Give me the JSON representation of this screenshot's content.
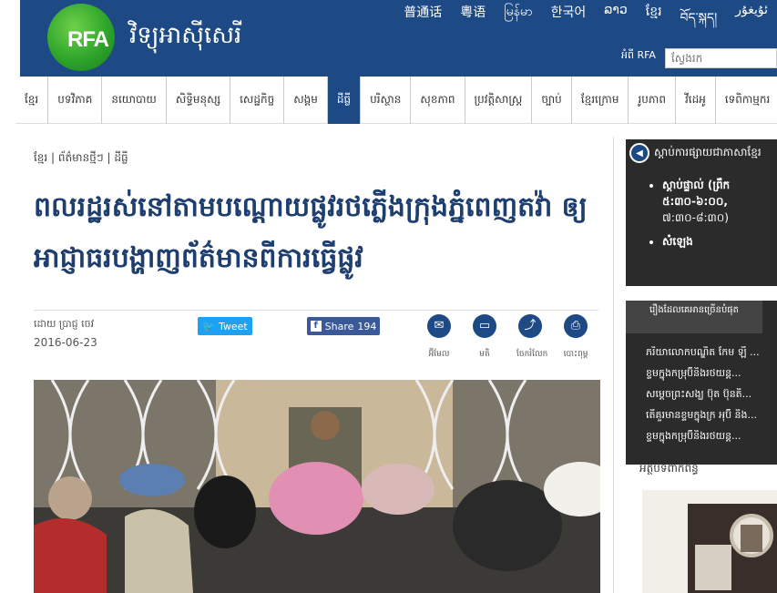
{
  "header": {
    "logo": "RFA",
    "site_name": "វិទ្យុអាស៊ីសេរី",
    "languages": [
      "普通话",
      "粵语",
      "မြန်မာ",
      "한국어",
      "ລາວ",
      "ខ្មែរ",
      "བོད་སྐད།",
      "ئۇيغۇر"
    ],
    "about": "អំពី RFA",
    "search_placeholder": "ស្វែងរក"
  },
  "nav": {
    "items": [
      "ខ្មែរ",
      "បទវិភាគ",
      "នយោបាយ",
      "សិទ្ធិមនុស្ស",
      "សេដ្ឋកិច្ច",
      "សង្គម",
      "ដីធ្លី",
      "បរិស្ថាន",
      "សុខភាព",
      "ប្រវត្តិសាស្ត្រ",
      "ច្បាប់",
      "ខ្មែរក្រោម",
      "រូបភាព",
      "វីដេអូ",
      "ទេពិកាម្មករ"
    ],
    "active_index": 6
  },
  "article": {
    "breadcrumb": "ខ្មែរ | ព័ត៌មានថ្មីៗ | ដីធ្លី",
    "title": "ពលរដ្ឋរស់នៅតាមបណ្ដោយផ្លូវរថភ្លើងក្រុងភ្នំពេញតវ៉ា ឲ្យអាជ្ញាធរបង្ហាញព័ត៌មានពីការធ្វើផ្លូវ",
    "byline": "ដោយ ប្រាជ្ញ ចេវ",
    "date": "2016-06-23",
    "tweet_label": "Tweet",
    "share_label": "Share",
    "share_count": "194",
    "tools": [
      {
        "label": "អ៊ីមែល",
        "icon": "email-icon"
      },
      {
        "label": "មតិ",
        "icon": "comment-icon"
      },
      {
        "label": "ចែករំលែក",
        "icon": "share-icon"
      },
      {
        "label": "បោះពុម្ព",
        "icon": "print-icon"
      }
    ]
  },
  "sidebar": {
    "listen_title": "ស្ដាប់ការផ្សាយជាភាសាខ្មែរ",
    "listen_items": [
      {
        "title": "ស្ដាប់ផ្ទាល់ (ព្រឹក ៥:៣០-៦:០០,",
        "sub": "៧:៣០-៨:៣០)"
      },
      {
        "title": "សំឡេង",
        "sub": ""
      }
    ],
    "popular_tab": "រឿងដែលគេអានច្រើនបំផុត",
    "popular_items": [
      "ភរិយាលោកបណ្ឌិត កែម ឡី ...",
      "ខ្ទមក្នុងកម្រុប៊ីនិងរថយន្ត...",
      "សម្ដេចព្រះសង្ឃ ប៊ុត ប៊ុនតិ...",
      "តើគួរមានខ្ទមក្នុងក្រ អុប៊ី និង...",
      "ខ្ទមក្នុងកម្រុប៊ីនិងរថយន្ត..."
    ],
    "label": "អត្ថបទពាក់ព័ន្ធ"
  }
}
